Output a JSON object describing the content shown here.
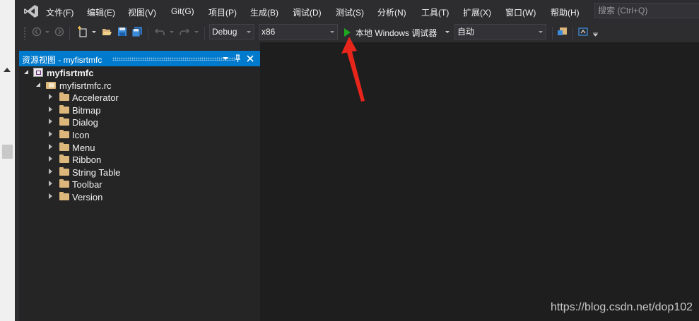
{
  "menu": {
    "items": [
      "文件(F)",
      "编辑(E)",
      "视图(V)",
      "Git(G)",
      "项目(P)",
      "生成(B)",
      "调试(D)",
      "测试(S)",
      "分析(N)",
      "工具(T)",
      "扩展(X)",
      "窗口(W)",
      "帮助(H)"
    ],
    "search_placeholder": "搜索 (Ctrl+Q)"
  },
  "toolbar": {
    "configuration": "Debug",
    "platform": "x86",
    "run_label": "本地 Windows 调试器",
    "run_mode": "自动"
  },
  "resource_view": {
    "title": "资源视图 - myfisrtmfc",
    "project": "myfisrtmfc",
    "rc_file": "myfisrtmfc.rc",
    "folders": [
      "Accelerator",
      "Bitmap",
      "Dialog",
      "Icon",
      "Menu",
      "Ribbon",
      "String Table",
      "Toolbar",
      "Version"
    ]
  },
  "watermark": "https://blog.csdn.net/dop102",
  "colors": {
    "title_bar": "#007acc",
    "arrow": "#e8251b",
    "play": "#1fa81f"
  }
}
